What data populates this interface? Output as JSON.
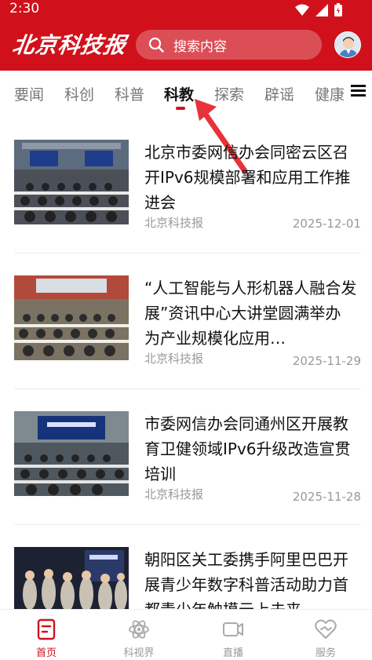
{
  "status": {
    "time": "2:30"
  },
  "header": {
    "logo": "北京科技报",
    "search_placeholder": "搜索内容",
    "brand_color": "#d0111b"
  },
  "tabs": [
    {
      "label": "要闻",
      "active": false
    },
    {
      "label": "科创",
      "active": false
    },
    {
      "label": "科普",
      "active": false
    },
    {
      "label": "科教",
      "active": true
    },
    {
      "label": "探索",
      "active": false
    },
    {
      "label": "辟谣",
      "active": false
    },
    {
      "label": "健康",
      "active": false
    }
  ],
  "news": [
    {
      "title": "北京市委网信办会同密云区召开IPv6规模部署和应用工作推进会",
      "source": "北京科技报",
      "date": "2025-12-01"
    },
    {
      "title": "“人工智能与人形机器人融合发展”资讯中心大讲堂圆满举办 为产业规模化应用…",
      "source": "北京科技报",
      "date": "2025-11-29"
    },
    {
      "title": "市委网信办会同通州区开展教育卫健领域IPv6升级改造宣贯培训",
      "source": "北京科技报",
      "date": "2025-11-28"
    },
    {
      "title": "朝阳区关工委携手阿里巴巴开展青少年数字科普活动助力首都青少年触摸云上未来",
      "source": "",
      "date": ""
    }
  ],
  "bottom_nav": [
    {
      "label": "首页",
      "icon": "home-doc-icon",
      "active": true
    },
    {
      "label": "科视界",
      "icon": "atom-icon",
      "active": false
    },
    {
      "label": "直播",
      "icon": "video-camera-icon",
      "active": false
    },
    {
      "label": "服务",
      "icon": "heart-service-icon",
      "active": false
    }
  ]
}
